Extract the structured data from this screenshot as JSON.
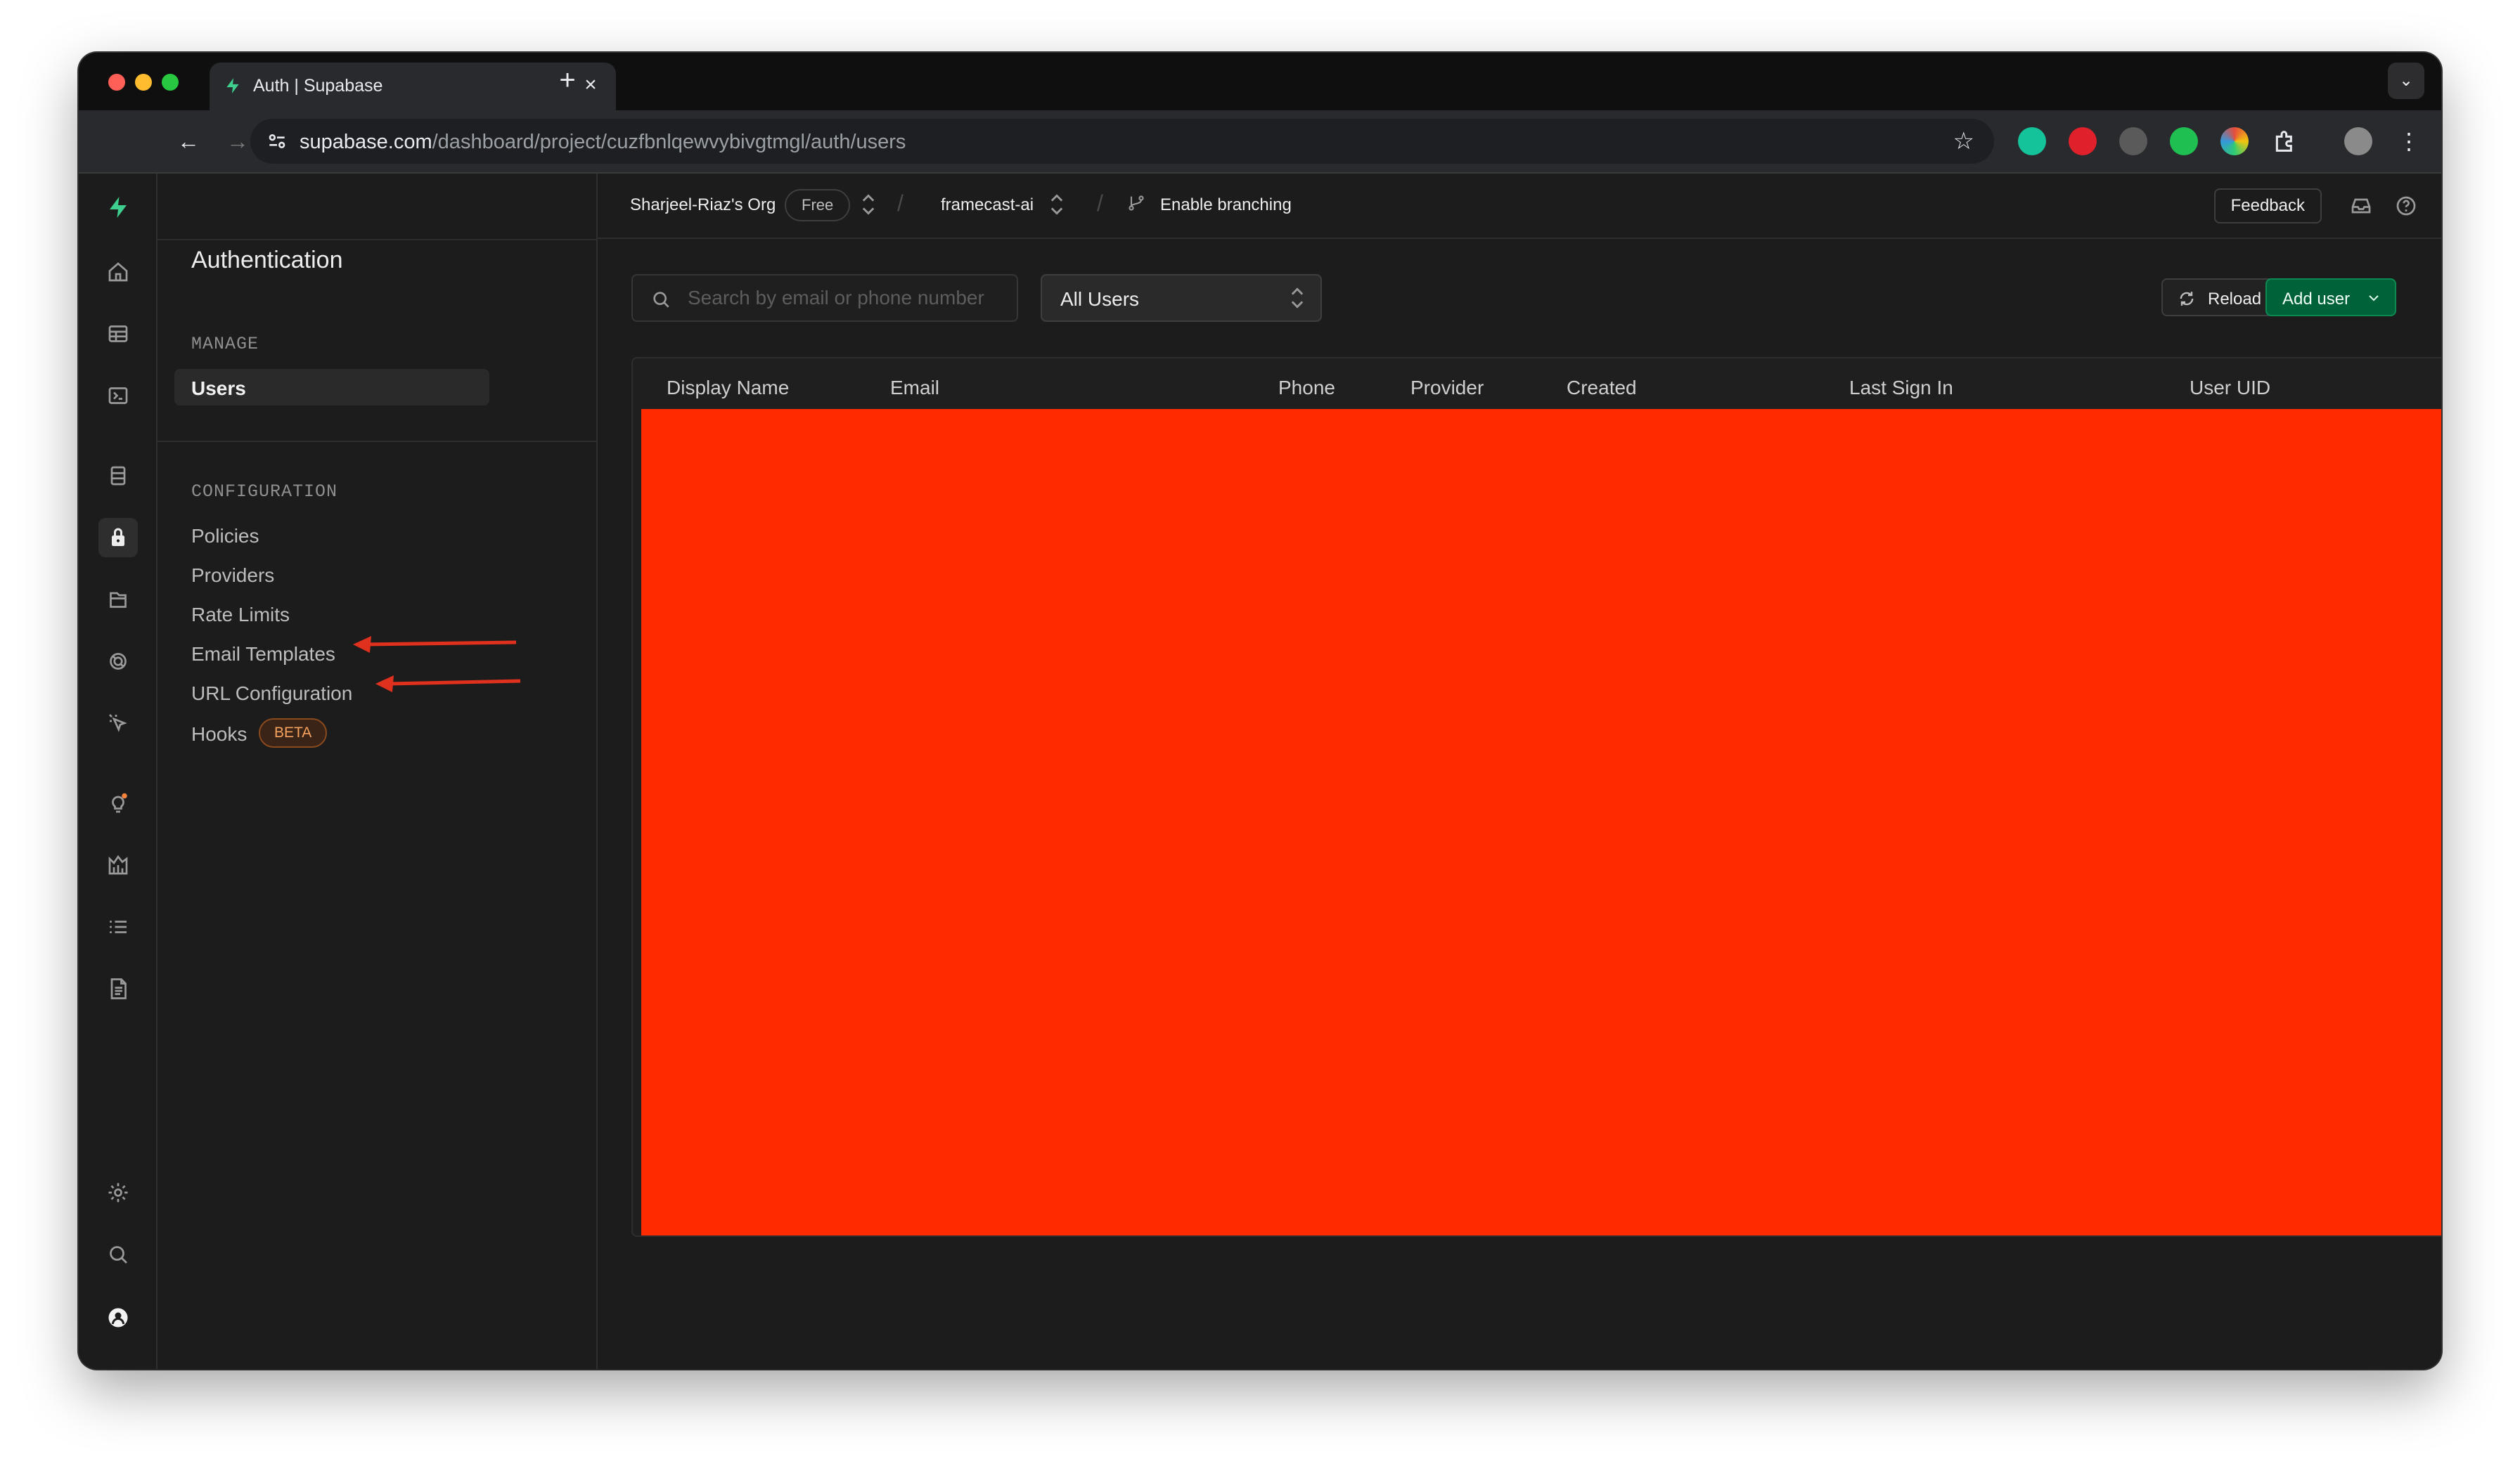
{
  "browser": {
    "tab_title": "Auth | Supabase",
    "url_host": "supabase.com",
    "url_path": "/dashboard/project/cuzfbnlqewvybivgtmgl/auth/users"
  },
  "sidemenu": {
    "title": "Authentication",
    "manage_label": "MANAGE",
    "manage_items": [
      "Users"
    ],
    "config_label": "CONFIGURATION",
    "config_items": [
      "Policies",
      "Providers",
      "Rate Limits",
      "Email Templates",
      "URL Configuration",
      "Hooks"
    ],
    "hooks_badge": "BETA"
  },
  "projectbar": {
    "org": "Sharjeel-Riaz's Org",
    "plan": "Free",
    "project": "framecast-ai",
    "branching": "Enable branching",
    "feedback": "Feedback"
  },
  "users": {
    "search_placeholder": "Search by email or phone number",
    "filter_value": "All Users",
    "reload_label": "Reload",
    "add_user_label": "Add user",
    "columns": [
      "Display Name",
      "Email",
      "Phone",
      "Provider",
      "Created",
      "Last Sign In",
      "User UID"
    ]
  },
  "colors": {
    "brand": "#3ecf8e",
    "redaction": "#ff2a00",
    "annotation_arrow": "#e0301e"
  }
}
